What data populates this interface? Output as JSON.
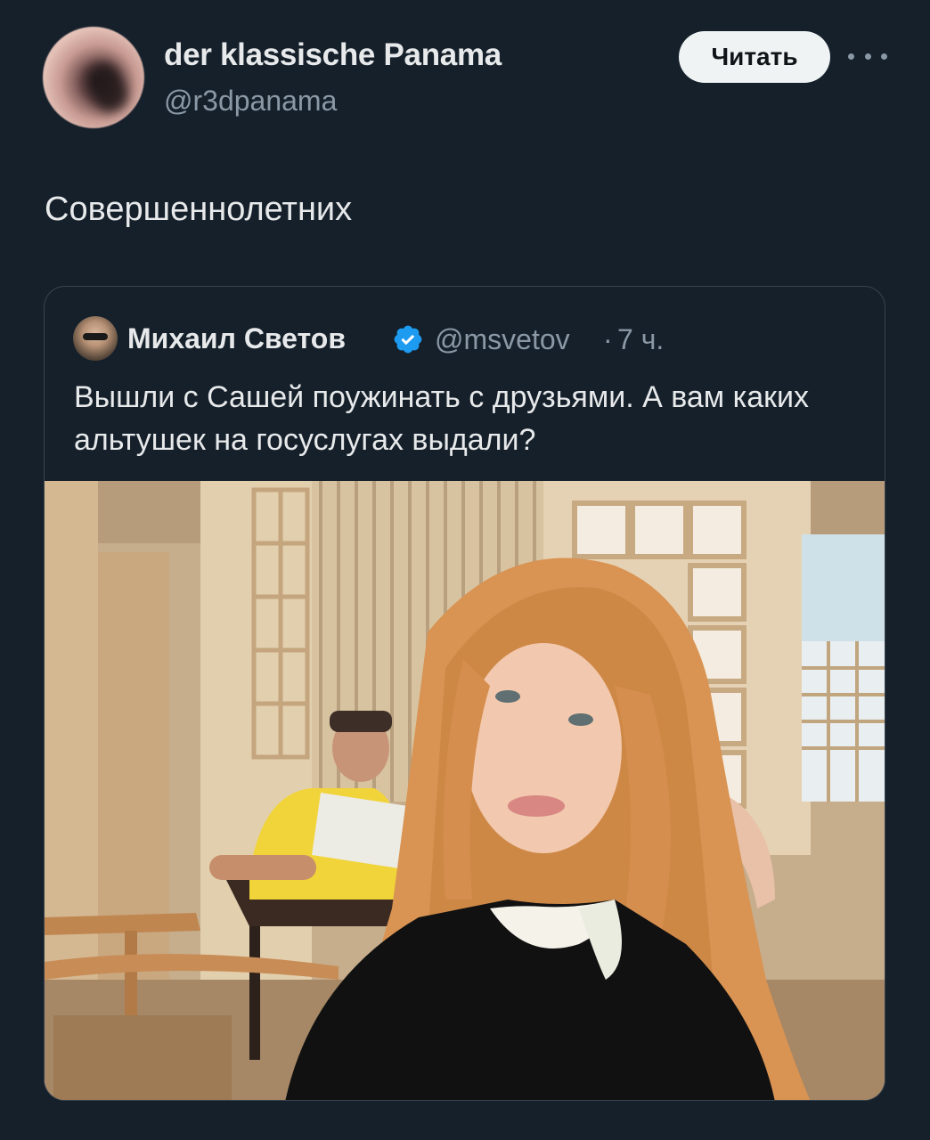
{
  "author": {
    "display_name": "der klassische Panama",
    "handle": "@r3dpanama",
    "avatar_icon": "profile-avatar"
  },
  "header": {
    "follow_label": "Читать",
    "more_icon": "more-icon"
  },
  "tweet": {
    "text": "Совершеннолетних"
  },
  "quote": {
    "author_name": "Михаил Светов",
    "verified_icon": "verified-badge-icon",
    "handle": "@msvetov",
    "separator": "·",
    "time": "7 ч.",
    "text": "Вышли с Сашей поужинать с друзьями. А вам каких альтушек на госуслугах выдали?",
    "media_icon": "photo"
  },
  "colors": {
    "background": "#15202b",
    "text": "#e7e9ea",
    "secondary": "#8b98a5",
    "verified": "#1d9bf0",
    "border": "#38444d"
  }
}
